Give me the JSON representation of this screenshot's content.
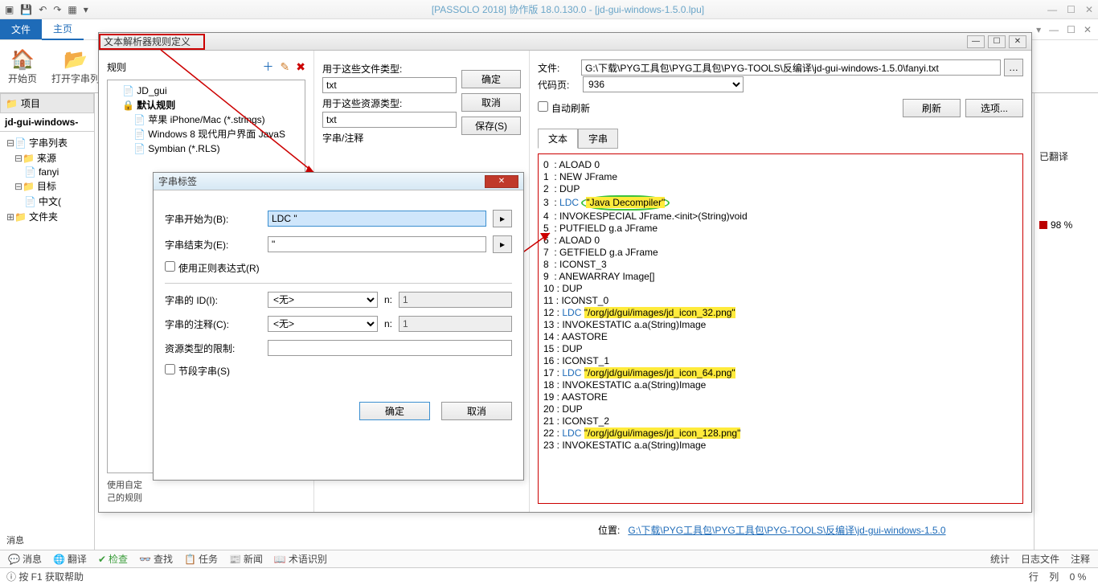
{
  "titlebar": {
    "title": "[PASSOLO 2018] 协作版 18.0.130.0 - [jd-gui-windows-1.5.0.lpu]"
  },
  "ribbon": {
    "file": "文件",
    "home": "主页"
  },
  "ribbon_items": {
    "start_page": "开始页",
    "open_string": "打开字串列"
  },
  "project_panel": {
    "title": "项目",
    "root": "jd-gui-windows-"
  },
  "tree": {
    "strings": "字串列表",
    "source": "来源",
    "fanyi": "fanyi",
    "target": "目标",
    "chinese": "中文(",
    "folders": "文件夹"
  },
  "right_panel": {
    "translated": "已翻译",
    "pct": "98 %"
  },
  "messages": "消息",
  "status_tabs": {
    "msg": "消息",
    "trans": "翻译",
    "check": "检查",
    "find": "查找",
    "task": "任务",
    "news": "新闻",
    "term": "术语识别",
    "stat": "统计",
    "logfile": "日志文件",
    "comment": "注释"
  },
  "statusbar": {
    "help": "按 F1 获取帮助",
    "row": "行",
    "col": "列",
    "pct": "0 %"
  },
  "parser": {
    "title": "文本解析器规则定义",
    "rules_label": "规则",
    "rules": [
      "JD_gui",
      "默认规则",
      "苹果 iPhone/Mac (*.strings)",
      "Windows 8 现代用户界面 JavaS",
      "Symbian (*.RLS)"
    ],
    "file_types_label": "用于这些文件类型:",
    "file_types_value": "txt",
    "res_types_label": "用于这些资源类型:",
    "res_types_value": "txt",
    "strnote_label": "字串/注释",
    "ok": "确定",
    "cancel": "取消",
    "save": "保存(S)",
    "file_label": "文件:",
    "file_path": "G:\\下载\\PYG工具包\\PYG工具包\\PYG-TOOLS\\反编译\\jd-gui-windows-1.5.0\\fanyi.txt",
    "codepage_label": "代码页:",
    "codepage_value": "936",
    "autorefresh": "自动刷新",
    "refresh": "刷新",
    "options": "选项...",
    "tab_text": "文本",
    "tab_string": "字串",
    "hint": "使用自定\n己的规则",
    "footer_loc_label": "位置:",
    "footer_loc_link": "G:\\下载\\PYG工具包\\PYG工具包\\PYG-TOOLS\\反编译\\jd-gui-windows-1.5.0"
  },
  "str_dialog": {
    "title": "字串标签",
    "begins": "字串开始为(B):",
    "begins_val": "LDC \"",
    "ends": "字串结束为(E):",
    "ends_val": "\"",
    "regex": "使用正则表达式(R)",
    "id_label": "字串的 ID(I):",
    "id_val": "<无>",
    "id_n": "1",
    "comment_label": "字串的注释(C):",
    "comment_val": "<无>",
    "comment_n": "1",
    "restrict": "资源类型的限制:",
    "segment": "节段字串(S)",
    "n": "n:",
    "ok": "确定",
    "cancel": "取消"
  },
  "code": {
    "lines": [
      {
        "n": "0",
        "t": ": ALOAD 0"
      },
      {
        "n": "1",
        "t": ": NEW JFrame"
      },
      {
        "n": "2",
        "t": ": DUP"
      },
      {
        "n": "3",
        "t": ": ",
        "ldc": "LDC ",
        "hl": "\"Java Decompiler\"",
        "oval": true
      },
      {
        "n": "4",
        "t": ": INVOKESPECIAL JFrame.<init>(String)void"
      },
      {
        "n": "5",
        "t": ": PUTFIELD g.a JFrame"
      },
      {
        "n": "6",
        "t": ": ALOAD 0"
      },
      {
        "n": "7",
        "t": ": GETFIELD g.a JFrame"
      },
      {
        "n": "8",
        "t": ": ICONST_3"
      },
      {
        "n": "9",
        "t": ": ANEWARRAY Image[]"
      },
      {
        "n": "10",
        "t": ": DUP"
      },
      {
        "n": "11",
        "t": ": ICONST_0"
      },
      {
        "n": "12",
        "t": ": ",
        "ldc": "LDC ",
        "hl": "\"/org/jd/gui/images/jd_icon_32.png\""
      },
      {
        "n": "13",
        "t": ": INVOKESTATIC a.a(String)Image"
      },
      {
        "n": "14",
        "t": ": AASTORE"
      },
      {
        "n": "15",
        "t": ": DUP"
      },
      {
        "n": "16",
        "t": ": ICONST_1"
      },
      {
        "n": "17",
        "t": ": ",
        "ldc": "LDC ",
        "hl": "\"/org/jd/gui/images/jd_icon_64.png\""
      },
      {
        "n": "18",
        "t": ": INVOKESTATIC a.a(String)Image"
      },
      {
        "n": "19",
        "t": ": AASTORE"
      },
      {
        "n": "20",
        "t": ": DUP"
      },
      {
        "n": "21",
        "t": ": ICONST_2"
      },
      {
        "n": "22",
        "t": ": ",
        "ldc": "LDC ",
        "hl": "\"/org/jd/gui/images/jd_icon_128.png\""
      },
      {
        "n": "23",
        "t": ": INVOKESTATIC a.a(String)Image"
      }
    ]
  }
}
